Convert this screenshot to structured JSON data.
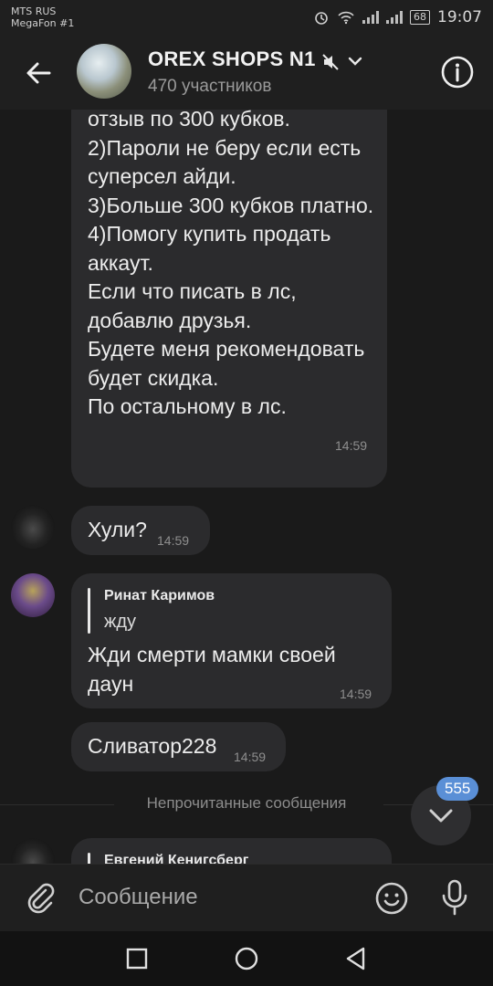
{
  "status_bar": {
    "carrier1": "MTS RUS",
    "carrier2": "MegaFon #1",
    "battery": "68",
    "time": "19:07"
  },
  "header": {
    "title": "OREX SHOPS N1",
    "subtitle": "470 участников"
  },
  "messages": {
    "long": {
      "text": "отзыв по 300 кубков.\n2)Пароли не беру если есть суперсел айди.\n3)Больше 300 кубков платно.\n4)Помогу купить продать аккаут.\nЕсли что писать в лс, добавлю друзья.\nБудете меня рекомендовать будет скидка.\nПо остальному в лс.",
      "time": "14:59"
    },
    "m2": {
      "text": "Хули?",
      "time": "14:59"
    },
    "m3": {
      "quote_author": "Ринат Каримов",
      "quote_text": "жду",
      "text": "Жди смерти мамки своей даун",
      "time": "14:59"
    },
    "m4": {
      "text": "Сливатор228",
      "time": "14:59"
    },
    "m5": {
      "quote_author": "Евгений Кенигсберг"
    }
  },
  "unread_label": "Непрочитанные сообщения",
  "unread_count": "555",
  "composer": {
    "placeholder": "Сообщение"
  },
  "icons": [
    "back-arrow-icon",
    "mute-icon",
    "chevron-down-icon",
    "info-icon",
    "attach-icon",
    "emoji-icon",
    "mic-icon",
    "scroll-down-icon",
    "nav-recent-icon",
    "nav-home-icon",
    "nav-back-icon"
  ]
}
